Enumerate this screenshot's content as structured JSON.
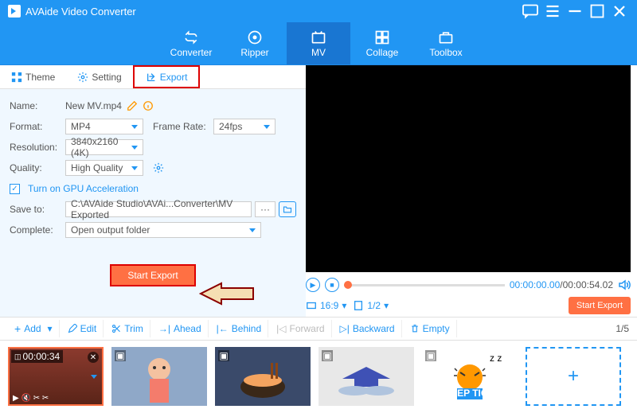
{
  "app": {
    "title": "AVAide Video Converter"
  },
  "nav": {
    "items": [
      "Converter",
      "Ripper",
      "MV",
      "Collage",
      "Toolbox"
    ],
    "active": 2
  },
  "tabs": {
    "theme": "Theme",
    "setting": "Setting",
    "export": "Export"
  },
  "form": {
    "name_label": "Name:",
    "name_value": "New MV.mp4",
    "format_label": "Format:",
    "format_value": "MP4",
    "framerate_label": "Frame Rate:",
    "framerate_value": "24fps",
    "resolution_label": "Resolution:",
    "resolution_value": "3840x2160 (4K)",
    "quality_label": "Quality:",
    "quality_value": "High Quality",
    "gpu_label": "Turn on GPU Acceleration",
    "saveto_label": "Save to:",
    "saveto_value": "C:\\AVAide Studio\\AVAi...Converter\\MV Exported",
    "dots": "···",
    "complete_label": "Complete:",
    "complete_value": "Open output folder",
    "start_label": "Start Export"
  },
  "preview": {
    "time_current": "00:00:00.00",
    "time_total": "/00:00:54.02",
    "aspect": "16:9",
    "page": "1/2",
    "export_label": "Start Export"
  },
  "toolbar": {
    "add": "Add",
    "edit": "Edit",
    "trim": "Trim",
    "ahead": "Ahead",
    "behind": "Behind",
    "forward": "Forward",
    "backward": "Backward",
    "empty": "Empty"
  },
  "counter": "1/5",
  "thumbs": {
    "badge_time": "00:00:34"
  }
}
